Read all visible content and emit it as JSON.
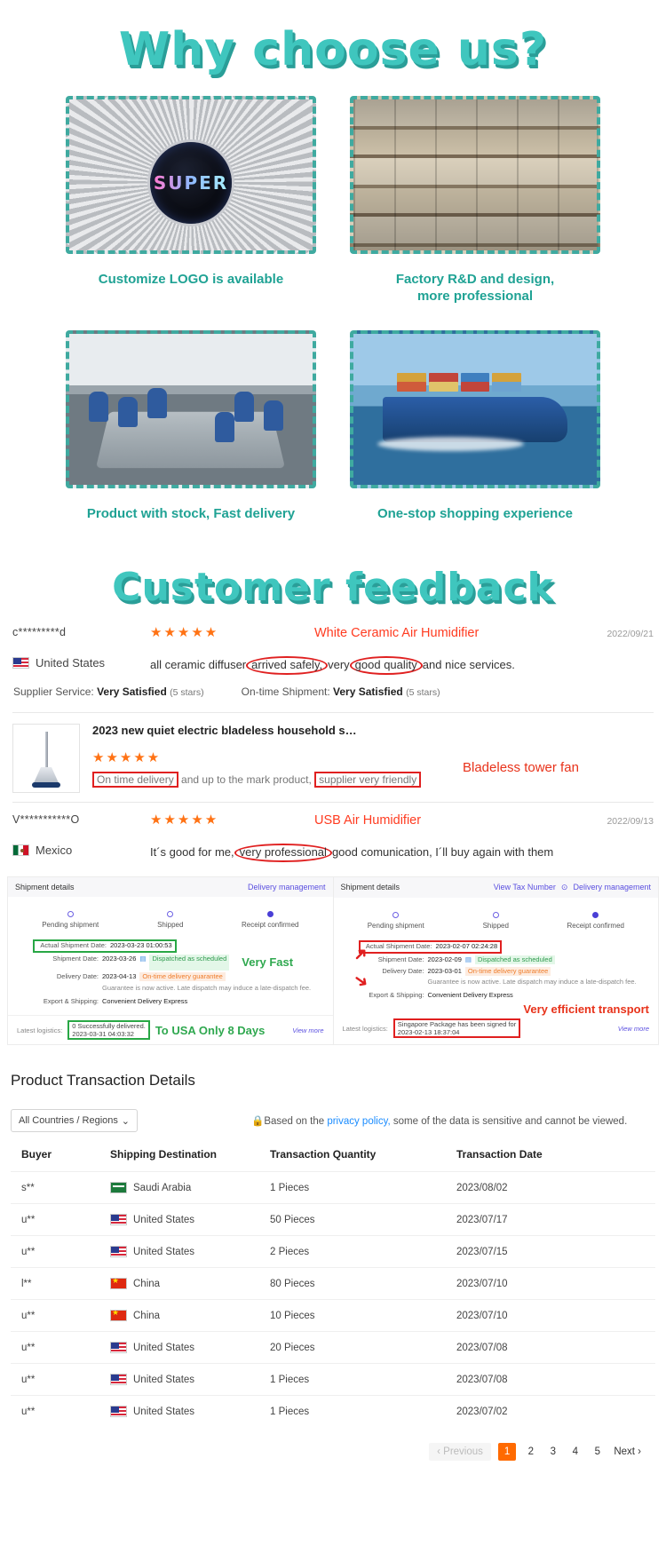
{
  "headings": {
    "why_choose": "Why choose us?",
    "customer_feedback": "Customer feedback"
  },
  "features": [
    {
      "caption": "Customize LOGO is available",
      "logo_text": "SUPER",
      "image": "fan-with-logo-photo"
    },
    {
      "caption": "Factory R&D and design,\nmore professional",
      "image": "warehouse-shelves-photo"
    },
    {
      "caption": "Product with stock, Fast delivery",
      "image": "meeting-room-photo"
    },
    {
      "caption": "One-stop shopping experience",
      "image": "container-ship-photo"
    }
  ],
  "reviews": [
    {
      "buyer": "c*********d",
      "country": "United States",
      "flag": "us-flag-icon",
      "stars": "★★★★★",
      "product": "White Ceramic Air Humidifier",
      "date": "2022/09/21",
      "body_1": "all ceramic diffuser",
      "body_hl1": "arrived safely,",
      "body_2": "very",
      "body_hl2": "good quality",
      "body_3": "and nice services.",
      "supplier_service_label": "Supplier Service:",
      "supplier_service_value": "Very Satisfied",
      "supplier_service_stars": "(5 stars)",
      "ontime_label": "On-time Shipment:",
      "ontime_value": "Very Satisfied",
      "ontime_stars": "(5 stars)"
    },
    {
      "product_name": "2023 new quiet electric bladeless household s…",
      "stars": "★★★★★",
      "body_hl1": "On time delivery",
      "body_2": "and up to the mark product,",
      "body_hl2": "supplier very friendly",
      "annotation": "Bladeless tower fan"
    },
    {
      "buyer": "V***********O",
      "country": "Mexico",
      "flag": "mx-flag-icon",
      "stars": "★★★★★",
      "product": "USB Air Humidifier",
      "date": "2022/09/13",
      "body_1": "It´s good for me,",
      "body_hl1": "very professional",
      "body_3": "good comunication, I´ll buy again with them"
    }
  ],
  "shipments": [
    {
      "title": "Shipment details",
      "links": [
        "Delivery management"
      ],
      "steps": [
        "Pending shipment",
        "Shipped",
        "Receipt confirmed"
      ],
      "actual_label": "Actual Shipment Date:",
      "actual_value": "2023-03-23 01:00:53",
      "shipment_label": "Shipment Date:",
      "shipment_value": "2023-03-26",
      "shipment_tag": "Dispatched as scheduled",
      "delivery_label": "Delivery Date:",
      "delivery_value": "2023-04-13",
      "delivery_tag": "On-time delivery guarantee",
      "note": "Guarantee is now active. Late dispatch may induce a late-dispatch fee.",
      "export_label": "Export & Shipping:",
      "export_value": "Convenient Delivery Express",
      "logistics_label": "Latest logistics:",
      "logistics_value": "0  Successfully delivered.",
      "logistics_time": "2023-03-31 04:03:32",
      "view_more": "View more",
      "ann_top": "Very Fast",
      "ann_bottom": "To USA Only 8 Days"
    },
    {
      "title": "Shipment details",
      "links": [
        "View Tax Number",
        "Delivery management"
      ],
      "steps": [
        "Pending shipment",
        "Shipped",
        "Receipt confirmed"
      ],
      "actual_label": "Actual Shipment Date:",
      "actual_value": "2023-02-07 02:24:28",
      "shipment_label": "Shipment Date:",
      "shipment_value": "2023-02-09",
      "shipment_tag": "Dispatched as scheduled",
      "delivery_label": "Delivery Date:",
      "delivery_value": "2023-03-01",
      "delivery_tag": "On-time delivery guarantee",
      "note": "Guarantee is now active. Late dispatch may induce a late-dispatch fee.",
      "export_label": "Export & Shipping:",
      "export_value": "Convenient Delivery Express",
      "logistics_label": "Latest logistics:",
      "logistics_value": "Singapore  Package has been signed for",
      "logistics_time": "2023-02-13 18:37:04",
      "view_more": "View more",
      "ann_bottom": "Very efficient transport"
    }
  ],
  "transactions": {
    "title": "Product Transaction Details",
    "filter_value": "All Countries / Regions",
    "privacy_prefix": "Based on the ",
    "privacy_link": "privacy policy,",
    "privacy_suffix": " some of the data is sensitive and cannot be viewed.",
    "columns": [
      "Buyer",
      "Shipping Destination",
      "Transaction Quantity",
      "Transaction Date"
    ],
    "rows": [
      {
        "buyer": "s**",
        "flag": "sa",
        "destination": "Saudi Arabia",
        "quantity": "1 Pieces",
        "date": "2023/08/02"
      },
      {
        "buyer": "u**",
        "flag": "us",
        "destination": "United States",
        "quantity": "50 Pieces",
        "date": "2023/07/17"
      },
      {
        "buyer": "u**",
        "flag": "us",
        "destination": "United States",
        "quantity": "2 Pieces",
        "date": "2023/07/15"
      },
      {
        "buyer": "l**",
        "flag": "cn",
        "destination": "China",
        "quantity": "80 Pieces",
        "date": "2023/07/10"
      },
      {
        "buyer": "u**",
        "flag": "cn",
        "destination": "China",
        "quantity": "10 Pieces",
        "date": "2023/07/10"
      },
      {
        "buyer": "u**",
        "flag": "us",
        "destination": "United States",
        "quantity": "20 Pieces",
        "date": "2023/07/08"
      },
      {
        "buyer": "u**",
        "flag": "us",
        "destination": "United States",
        "quantity": "1 Pieces",
        "date": "2023/07/08"
      },
      {
        "buyer": "u**",
        "flag": "us",
        "destination": "United States",
        "quantity": "1 Pieces",
        "date": "2023/07/02"
      }
    ],
    "pagination": {
      "previous": "Previous",
      "pages": [
        "1",
        "2",
        "3",
        "4",
        "5"
      ],
      "next": "Next",
      "active": "1"
    }
  },
  "colors": {
    "teal": "#3fc6be",
    "teal_dark": "#1fa294",
    "orange": "#ff7214",
    "red": "#ff3b20",
    "accent_orange": "#ff6a00",
    "link_blue": "#1a8cff",
    "purple": "#5a4fe0"
  }
}
